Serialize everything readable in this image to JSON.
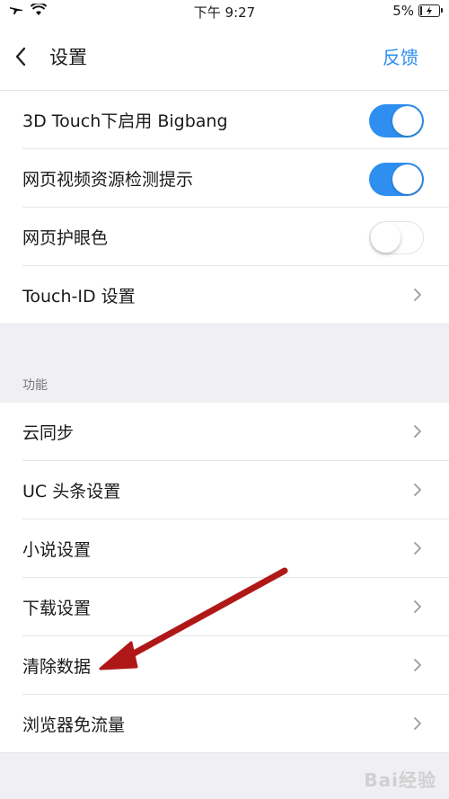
{
  "status_bar": {
    "time": "下午 9:27",
    "battery": "5%"
  },
  "nav": {
    "title": "设置",
    "feedback": "反馈"
  },
  "settings_group": [
    {
      "label": "3D Touch下启用 Bigbang",
      "toggle": "on"
    },
    {
      "label": "网页视频资源检测提示",
      "toggle": "on"
    },
    {
      "label": "网页护眼色",
      "toggle": "off"
    },
    {
      "label": "Touch-ID 设置"
    }
  ],
  "functions": {
    "section_label": "功能",
    "items": [
      {
        "label": "云同步"
      },
      {
        "label": "UC 头条设置"
      },
      {
        "label": "小说设置"
      },
      {
        "label": "下载设置"
      },
      {
        "label": "清除数据"
      },
      {
        "label": "浏览器免流量"
      }
    ]
  },
  "watermark": "Bai经验",
  "colors": {
    "accent": "#2a8df0",
    "toggle_on": "#2e8ff0",
    "annotation_arrow": "#b01818"
  }
}
